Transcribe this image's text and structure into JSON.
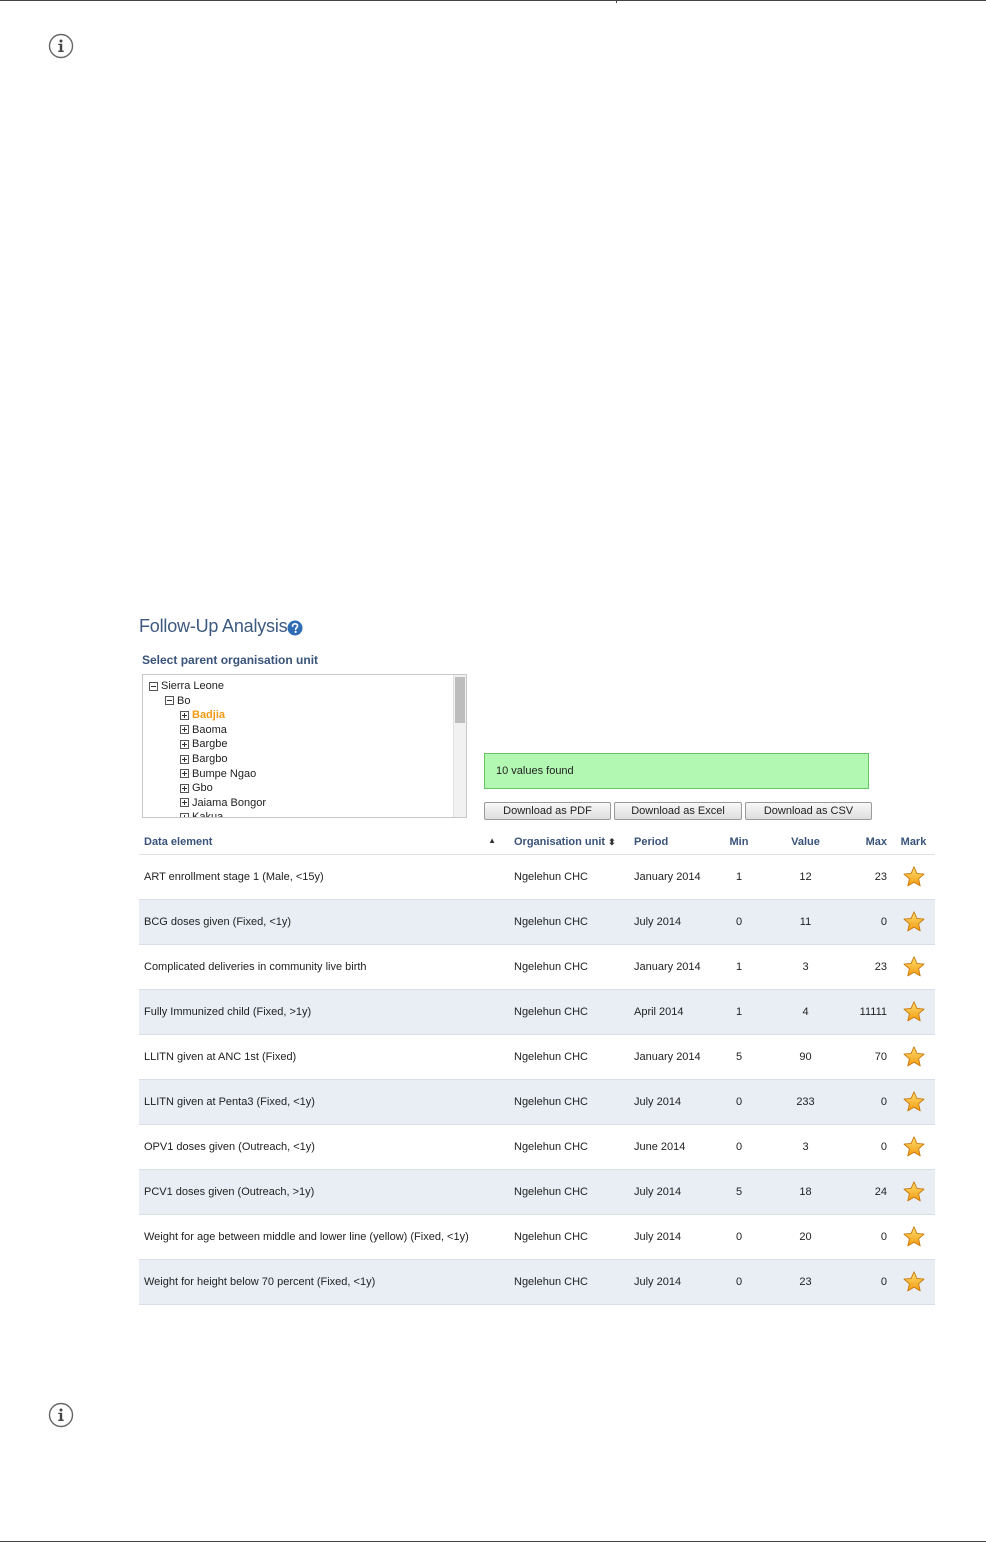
{
  "page": {
    "title": "Follow-Up Analysis"
  },
  "tree": {
    "label": "Select parent organisation unit",
    "nodes": [
      {
        "label": "Sierra Leone",
        "level": 0,
        "expanded": true,
        "selected": false
      },
      {
        "label": "Bo",
        "level": 1,
        "expanded": true,
        "selected": false
      },
      {
        "label": "Badjia",
        "level": 2,
        "expanded": false,
        "selected": true
      },
      {
        "label": "Baoma",
        "level": 2,
        "expanded": false,
        "selected": false
      },
      {
        "label": "Bargbe",
        "level": 2,
        "expanded": false,
        "selected": false
      },
      {
        "label": "Bargbo",
        "level": 2,
        "expanded": false,
        "selected": false
      },
      {
        "label": "Bumpe Ngao",
        "level": 2,
        "expanded": false,
        "selected": false
      },
      {
        "label": "Gbo",
        "level": 2,
        "expanded": false,
        "selected": false
      },
      {
        "label": "Jaiama Bongor",
        "level": 2,
        "expanded": false,
        "selected": false
      },
      {
        "label": "Kakua",
        "level": 2,
        "expanded": false,
        "selected": false
      }
    ]
  },
  "status": {
    "message": "10 values found",
    "color": "#b2f7b2"
  },
  "downloads": {
    "pdf": "Download as PDF",
    "excel": "Download as Excel",
    "csv": "Download as CSV"
  },
  "table": {
    "headers": {
      "data_element": "Data element",
      "org_unit": "Organisation unit",
      "period": "Period",
      "min": "Min",
      "value": "Value",
      "max": "Max",
      "mark": "Mark"
    },
    "rows": [
      {
        "data_element": "ART enrollment stage 1 (Male, <15y)",
        "org_unit": "Ngelehun CHC",
        "period": "January 2014",
        "min": "1",
        "value": "12",
        "max": "23"
      },
      {
        "data_element": "BCG doses given (Fixed, <1y)",
        "org_unit": "Ngelehun CHC",
        "period": "July 2014",
        "min": "0",
        "value": "11",
        "max": "0"
      },
      {
        "data_element": "Complicated deliveries in community live birth",
        "org_unit": "Ngelehun CHC",
        "period": "January 2014",
        "min": "1",
        "value": "3",
        "max": "23"
      },
      {
        "data_element": "Fully Immunized child (Fixed, >1y)",
        "org_unit": "Ngelehun CHC",
        "period": "April 2014",
        "min": "1",
        "value": "4",
        "max": "11111"
      },
      {
        "data_element": "LLITN given at ANC 1st (Fixed)",
        "org_unit": "Ngelehun CHC",
        "period": "January 2014",
        "min": "5",
        "value": "90",
        "max": "70"
      },
      {
        "data_element": "LLITN given at Penta3 (Fixed, <1y)",
        "org_unit": "Ngelehun CHC",
        "period": "July 2014",
        "min": "0",
        "value": "233",
        "max": "0"
      },
      {
        "data_element": "OPV1 doses given (Outreach, <1y)",
        "org_unit": "Ngelehun CHC",
        "period": "June 2014",
        "min": "0",
        "value": "3",
        "max": "0"
      },
      {
        "data_element": "PCV1 doses given (Outreach, >1y)",
        "org_unit": "Ngelehun CHC",
        "period": "July 2014",
        "min": "5",
        "value": "18",
        "max": "24"
      },
      {
        "data_element": "Weight for age between middle and lower line (yellow) (Fixed, <1y)",
        "org_unit": "Ngelehun CHC",
        "period": "July 2014",
        "min": "0",
        "value": "20",
        "max": "0"
      },
      {
        "data_element": "Weight for height below 70 percent (Fixed, <1y)",
        "org_unit": "Ngelehun CHC",
        "period": "July 2014",
        "min": "0",
        "value": "23",
        "max": "0"
      }
    ]
  },
  "icons": {
    "info": "info-icon",
    "help": "help-icon",
    "mark": "star-icon",
    "accent": "#3d5a80",
    "selected_color": "#f09a16",
    "star_color": "#f7b21a"
  }
}
